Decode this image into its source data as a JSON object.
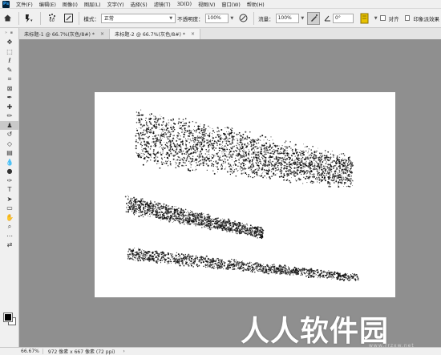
{
  "app": {
    "logo": "Ps"
  },
  "menu": [
    "文件(F)",
    "编辑(E)",
    "图像(I)",
    "图层(L)",
    "文字(Y)",
    "选择(S)",
    "滤镜(T)",
    "3D(D)",
    "视图(V)",
    "窗口(W)",
    "帮助(H)"
  ],
  "options": {
    "brush_size": "60",
    "mode_label": "模式：",
    "mode_value": "正常",
    "opacity_label": "不透明度：",
    "opacity_value": "100%",
    "flow_label": "流量：",
    "flow_value": "100%",
    "angle_value": "0°",
    "align_label": "对齐",
    "sample_label": "印象派效果"
  },
  "tabs": [
    {
      "label": "未标题-1 @ 66.7%(灰色/8#) *",
      "close": "×"
    },
    {
      "label": "未标题-2 @ 66.7%(灰色/8#) *",
      "close": "×"
    }
  ],
  "tools": [
    {
      "icon": "move-icon",
      "glyph": "✥"
    },
    {
      "icon": "marquee-icon",
      "glyph": "⬚"
    },
    {
      "icon": "lasso-icon",
      "glyph": "ℓ"
    },
    {
      "icon": "quick-select-icon",
      "glyph": "✎"
    },
    {
      "icon": "crop-icon",
      "glyph": "⌗"
    },
    {
      "icon": "frame-icon",
      "glyph": "⊠"
    },
    {
      "icon": "eyedropper-icon",
      "glyph": "✒"
    },
    {
      "icon": "healing-icon",
      "glyph": "✚"
    },
    {
      "icon": "brush-icon",
      "glyph": "✏"
    },
    {
      "icon": "clone-stamp-icon",
      "glyph": "♟"
    },
    {
      "icon": "history-brush-icon",
      "glyph": "↺"
    },
    {
      "icon": "eraser-icon",
      "glyph": "◇"
    },
    {
      "icon": "gradient-icon",
      "glyph": "▤"
    },
    {
      "icon": "blur-icon",
      "glyph": "💧"
    },
    {
      "icon": "dodge-icon",
      "glyph": "●"
    },
    {
      "icon": "pen-icon",
      "glyph": "✑"
    },
    {
      "icon": "type-icon",
      "glyph": "T"
    },
    {
      "icon": "path-select-icon",
      "glyph": "➤"
    },
    {
      "icon": "rectangle-icon",
      "glyph": "▭"
    },
    {
      "icon": "hand-icon",
      "glyph": "✋"
    },
    {
      "icon": "zoom-icon",
      "glyph": "⌕"
    },
    {
      "icon": "more-tools-icon",
      "glyph": "⋯"
    },
    {
      "icon": "swap-colors-icon",
      "glyph": "⇄"
    }
  ],
  "colors": {
    "foreground": "#000000",
    "background": "#ffffff",
    "workspace": "#8f8f8f"
  },
  "status": {
    "zoom": "66.67%",
    "doc_info": "972 像素 x 667 像素 (72 ppi)",
    "arrow": "›"
  },
  "watermark": {
    "title": "人人软件园",
    "url": "www.rrzxw.net"
  }
}
